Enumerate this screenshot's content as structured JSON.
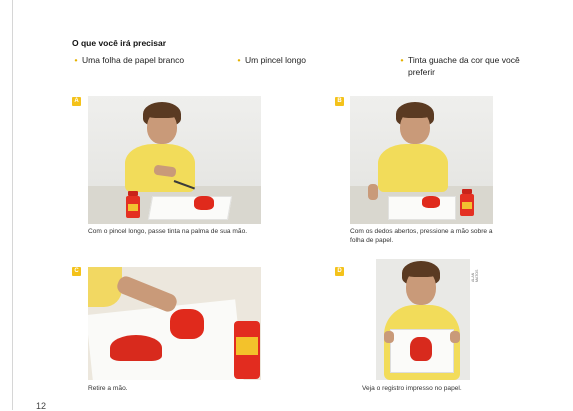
{
  "page": {
    "number": "12"
  },
  "materials": {
    "heading": "O que você irá precisar",
    "items": [
      {
        "text": "Uma folha de papel branco"
      },
      {
        "text": "Um pincel longo"
      },
      {
        "text": "Tinta guache da cor que você preferir"
      }
    ]
  },
  "steps": [
    {
      "badge": "A",
      "caption": "Com o pincel longo, passe tinta na palma de sua mão."
    },
    {
      "badge": "B",
      "caption": "Com os dedos abertos, pressione a mão sobre a folha de papel."
    },
    {
      "badge": "C",
      "caption": "Retire a mão."
    },
    {
      "badge": "D",
      "caption": "Veja o registro impresso no papel."
    }
  ],
  "photo_credit": "ALAN MATOS",
  "colors": {
    "badge": "#f4c21a",
    "bullet": "#e5b100",
    "paint": "#e02a1c",
    "shirt": "#f2dc5a"
  }
}
